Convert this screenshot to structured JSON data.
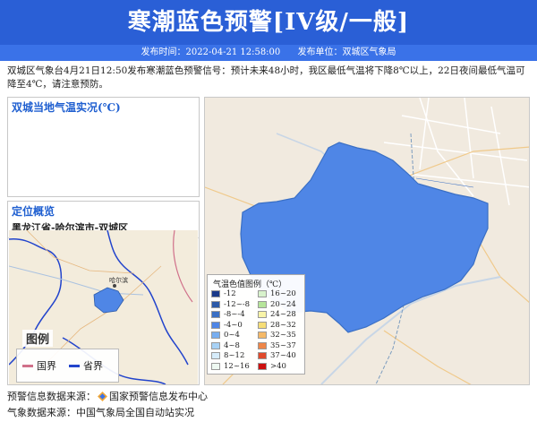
{
  "header": {
    "title": "寒潮蓝色预警[IV级/一般]",
    "publish_time": "发布时间：2022-04-21 12:58:00",
    "publisher": "发布单位：双城区气象局"
  },
  "description": "双城区气象台4月21日12:50发布寒潮蓝色预警信号：预计未来48小时，我区最低气温将下降8℃以上，22日夜间最低气温可降至4℃，请注意预防。",
  "temp_panel": {
    "title": "双城当地气温实况(℃)"
  },
  "location_panel": {
    "title": "定位概览",
    "path": "黑龙江省-哈尔滨市-双城区",
    "map_label": "哈尔滨",
    "legend": {
      "title": "图例",
      "items": [
        {
          "label": "国界",
          "color": "#d0708a"
        },
        {
          "label": "省界",
          "color": "#2244cc"
        }
      ]
    }
  },
  "main_map": {
    "region_color": "#4f86e6",
    "legend": {
      "title": "气温色值图例（℃）",
      "left": [
        {
          "label": "-12",
          "color": "#1a3a8a"
        },
        {
          "label": "-12~-8",
          "color": "#2c5aa8"
        },
        {
          "label": "-8~-4",
          "color": "#3a6fc4"
        },
        {
          "label": "-4~0",
          "color": "#4f86e6"
        },
        {
          "label": "0~4",
          "color": "#78aef0"
        },
        {
          "label": "4~8",
          "color": "#a8d2f6"
        },
        {
          "label": "8~12",
          "color": "#d6ecfb"
        },
        {
          "label": "12~16",
          "color": "#eef9f2"
        }
      ],
      "right": [
        {
          "label": "16~20",
          "color": "#d8f2cc"
        },
        {
          "label": "20~24",
          "color": "#b6e59a"
        },
        {
          "label": "24~28",
          "color": "#f8f4a8"
        },
        {
          "label": "28~32",
          "color": "#f6de78"
        },
        {
          "label": "32~35",
          "color": "#f5b968"
        },
        {
          "label": "35~37",
          "color": "#ee8648"
        },
        {
          "label": "37~40",
          "color": "#e04a2c"
        },
        {
          "label": ">40",
          "color": "#cc1010"
        }
      ]
    }
  },
  "footer": {
    "warning_source_label": "预警信息数据来源：",
    "warning_source": "国家预警信息发布中心",
    "weather_source_label": "气象数据来源：",
    "weather_source": "中国气象局全国自动站实况"
  }
}
